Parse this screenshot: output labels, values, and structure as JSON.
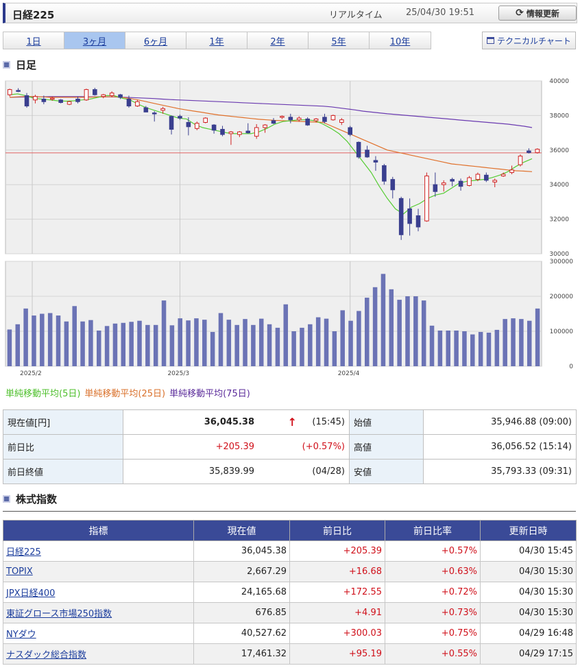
{
  "header": {
    "title": "日経225",
    "realtime_label": "リアルタイム",
    "datetime": "25/04/30 19:51",
    "refresh_label": "情報更新",
    "refresh_icon": "refresh-icon"
  },
  "period_tabs": [
    {
      "label": "1日",
      "active": false
    },
    {
      "label": "3ヶ月",
      "active": true
    },
    {
      "label": "6ヶ月",
      "active": false
    },
    {
      "label": "1年",
      "active": false
    },
    {
      "label": "2年",
      "active": false
    },
    {
      "label": "5年",
      "active": false
    },
    {
      "label": "10年",
      "active": false
    }
  ],
  "technical_button": {
    "label": "テクニカルチャート",
    "icon": "window-icon"
  },
  "chart_section_title": "日足",
  "chart_data": {
    "type": "candlestick",
    "price_axis": {
      "ticks": [
        "40000",
        "38000",
        "36000",
        "34000",
        "32000",
        "30000"
      ],
      "ylim": [
        30000,
        40000
      ]
    },
    "volume_axis": {
      "ticks": [
        "300000",
        "200000",
        "100000",
        "0"
      ],
      "ylim": [
        0,
        300000
      ]
    },
    "x_labels": [
      {
        "label": "2025/2",
        "index": 2
      },
      {
        "label": "2025/3",
        "index": 20
      },
      {
        "label": "2025/4",
        "index": 40
      }
    ],
    "reference_line": 35840,
    "colors": {
      "up": "#d02020",
      "down": "#3a3f8f",
      "ma5": "#55cc33",
      "ma25": "#e0702a",
      "ma75": "#6a3ab0",
      "volume": "#6b73b5"
    },
    "candles": [
      {
        "o": 39200,
        "h": 39550,
        "l": 39100,
        "c": 39500
      },
      {
        "o": 39450,
        "h": 39580,
        "l": 39350,
        "c": 39420
      },
      {
        "o": 39150,
        "h": 39300,
        "l": 38450,
        "c": 38550
      },
      {
        "o": 38900,
        "h": 39200,
        "l": 38700,
        "c": 39100
      },
      {
        "o": 38950,
        "h": 39150,
        "l": 38650,
        "c": 38800
      },
      {
        "o": 38950,
        "h": 39100,
        "l": 38850,
        "c": 39000
      },
      {
        "o": 38900,
        "h": 38950,
        "l": 38700,
        "c": 38750
      },
      {
        "o": 38650,
        "h": 38850,
        "l": 38600,
        "c": 38800
      },
      {
        "o": 38950,
        "h": 39100,
        "l": 38700,
        "c": 38800
      },
      {
        "o": 38900,
        "h": 39550,
        "l": 38850,
        "c": 39500
      },
      {
        "o": 39500,
        "h": 39600,
        "l": 39150,
        "c": 39200
      },
      {
        "o": 39100,
        "h": 39250,
        "l": 39000,
        "c": 39200
      },
      {
        "o": 39150,
        "h": 39400,
        "l": 39050,
        "c": 39300
      },
      {
        "o": 39200,
        "h": 39250,
        "l": 38950,
        "c": 39050
      },
      {
        "o": 38950,
        "h": 39150,
        "l": 38450,
        "c": 38550
      },
      {
        "o": 38550,
        "h": 38900,
        "l": 38500,
        "c": 38800
      },
      {
        "o": 38450,
        "h": 38550,
        "l": 38200,
        "c": 38200
      },
      {
        "o": 38150,
        "h": 38250,
        "l": 37650,
        "c": 38100
      },
      {
        "o": 38300,
        "h": 38500,
        "l": 38100,
        "c": 38400
      },
      {
        "o": 37950,
        "h": 38000,
        "l": 36900,
        "c": 37200
      },
      {
        "o": 37950,
        "h": 38050,
        "l": 37750,
        "c": 37850
      },
      {
        "o": 37600,
        "h": 37900,
        "l": 36850,
        "c": 37350
      },
      {
        "o": 37250,
        "h": 37650,
        "l": 37150,
        "c": 37550
      },
      {
        "o": 37600,
        "h": 37900,
        "l": 37550,
        "c": 37850
      },
      {
        "o": 37450,
        "h": 37500,
        "l": 36950,
        "c": 37150
      },
      {
        "o": 37200,
        "h": 37400,
        "l": 36800,
        "c": 36900
      },
      {
        "o": 36950,
        "h": 37100,
        "l": 36300,
        "c": 37050
      },
      {
        "o": 36900,
        "h": 37100,
        "l": 36750,
        "c": 37050
      },
      {
        "o": 37100,
        "h": 37550,
        "l": 36950,
        "c": 37000
      },
      {
        "o": 36800,
        "h": 37500,
        "l": 36650,
        "c": 37300
      },
      {
        "o": 37300,
        "h": 37500,
        "l": 37000,
        "c": 37450
      },
      {
        "o": 37700,
        "h": 37850,
        "l": 37500,
        "c": 37550
      },
      {
        "o": 37900,
        "h": 38000,
        "l": 37800,
        "c": 37950
      },
      {
        "o": 37900,
        "h": 38100,
        "l": 37550,
        "c": 37750
      },
      {
        "o": 37750,
        "h": 37950,
        "l": 37650,
        "c": 37850
      },
      {
        "o": 37800,
        "h": 37900,
        "l": 37400,
        "c": 37450
      },
      {
        "o": 37700,
        "h": 37850,
        "l": 37600,
        "c": 37800
      },
      {
        "o": 37900,
        "h": 38100,
        "l": 37550,
        "c": 37650
      },
      {
        "o": 37750,
        "h": 38050,
        "l": 37700,
        "c": 38000
      },
      {
        "o": 37600,
        "h": 37850,
        "l": 37450,
        "c": 37750
      },
      {
        "o": 37300,
        "h": 37400,
        "l": 36800,
        "c": 36900
      },
      {
        "o": 36450,
        "h": 36500,
        "l": 35500,
        "c": 35600
      },
      {
        "o": 36000,
        "h": 36250,
        "l": 35550,
        "c": 35600
      },
      {
        "o": 35400,
        "h": 35650,
        "l": 34800,
        "c": 35300
      },
      {
        "o": 35100,
        "h": 35200,
        "l": 34000,
        "c": 34200
      },
      {
        "o": 34300,
        "h": 34450,
        "l": 33200,
        "c": 33700
      },
      {
        "o": 33200,
        "h": 33300,
        "l": 30800,
        "c": 31100
      },
      {
        "o": 32600,
        "h": 33200,
        "l": 31050,
        "c": 31750
      },
      {
        "o": 32200,
        "h": 32600,
        "l": 31300,
        "c": 31550
      },
      {
        "o": 31900,
        "h": 34700,
        "l": 31850,
        "c": 34500
      },
      {
        "o": 34000,
        "h": 34700,
        "l": 33300,
        "c": 33600
      },
      {
        "o": 34000,
        "h": 34250,
        "l": 33600,
        "c": 34100
      },
      {
        "o": 34300,
        "h": 34400,
        "l": 33900,
        "c": 34200
      },
      {
        "o": 34200,
        "h": 34350,
        "l": 33650,
        "c": 33900
      },
      {
        "o": 33950,
        "h": 34500,
        "l": 33900,
        "c": 34400
      },
      {
        "o": 34300,
        "h": 34700,
        "l": 34200,
        "c": 34600
      },
      {
        "o": 34550,
        "h": 34700,
        "l": 34150,
        "c": 34250
      },
      {
        "o": 34150,
        "h": 34350,
        "l": 33850,
        "c": 34250
      },
      {
        "o": 34500,
        "h": 34700,
        "l": 34450,
        "c": 34600
      },
      {
        "o": 34700,
        "h": 35100,
        "l": 34600,
        "c": 34850
      },
      {
        "o": 35150,
        "h": 35750,
        "l": 35050,
        "c": 35650
      },
      {
        "o": 35950,
        "h": 36100,
        "l": 35800,
        "c": 35850
      },
      {
        "o": 35850,
        "h": 36100,
        "l": 35800,
        "c": 36050
      }
    ],
    "volume": [
      105000,
      120000,
      165000,
      145000,
      150000,
      152000,
      145000,
      128000,
      172000,
      128000,
      132000,
      102000,
      115000,
      122000,
      124000,
      127000,
      130000,
      118000,
      118000,
      188000,
      117000,
      137000,
      131000,
      137000,
      133000,
      98000,
      152000,
      133000,
      118000,
      135000,
      118000,
      136000,
      120000,
      110000,
      177000,
      100000,
      110000,
      120000,
      140000,
      136000,
      100000,
      160000,
      130000,
      158000,
      196000,
      226000,
      264000,
      220000,
      190000,
      200000,
      200000,
      188000,
      116000,
      102000,
      102000,
      102000,
      100000,
      91000,
      98000,
      96000,
      104000,
      135000,
      137000,
      135000,
      130000,
      165000
    ],
    "ma5": [
      39200,
      39250,
      39150,
      39000,
      38950,
      38900,
      38850,
      38830,
      38850,
      38900,
      38950,
      39050,
      39150,
      39150,
      39000,
      38900,
      38650,
      38450,
      38300,
      38150,
      38000,
      37850,
      37800,
      37500,
      37300,
      37200,
      37100,
      37000,
      36950,
      36950,
      36950,
      37050,
      37250,
      37500,
      37650,
      37700,
      37750,
      37750,
      37700,
      37500,
      37250,
      36950,
      36500,
      35900,
      35300,
      34700,
      33900,
      33200,
      32600,
      32300,
      32700,
      32900,
      33200,
      33400,
      33500,
      33800,
      34100,
      34200,
      34250,
      34300,
      34400,
      34550,
      34750,
      35050,
      35300,
      35500
    ],
    "ma25": [
      39050,
      39080,
      39100,
      39100,
      39080,
      39050,
      39050,
      39050,
      39050,
      39050,
      39060,
      39070,
      39080,
      39080,
      39050,
      38980,
      38900,
      38800,
      38700,
      38600,
      38500,
      38400,
      38320,
      38250,
      38180,
      38100,
      38030,
      37980,
      37930,
      37880,
      37830,
      37780,
      37750,
      37720,
      37700,
      37680,
      37660,
      37640,
      37620,
      37600,
      37400,
      37200,
      37000,
      36800,
      36600,
      36400,
      36200,
      36000,
      35900,
      35800,
      35700,
      35600,
      35500,
      35400,
      35300,
      35200,
      35150,
      35100,
      35050,
      35000,
      34950,
      34900,
      34850,
      34800,
      34780,
      34750
    ],
    "ma75": [
      39050,
      39060,
      39070,
      39080,
      39080,
      39090,
      39090,
      39090,
      39090,
      39090,
      39080,
      39080,
      39080,
      39070,
      39060,
      39040,
      39020,
      39000,
      38980,
      38950,
      38920,
      38900,
      38880,
      38860,
      38840,
      38820,
      38800,
      38780,
      38760,
      38740,
      38720,
      38700,
      38680,
      38660,
      38640,
      38620,
      38600,
      38580,
      38560,
      38540,
      38500,
      38440,
      38380,
      38320,
      38250,
      38200,
      38150,
      38100,
      38060,
      38020,
      37980,
      37940,
      37900,
      37860,
      37820,
      37780,
      37740,
      37700,
      37660,
      37620,
      37580,
      37540,
      37500,
      37440,
      37380,
      37300
    ]
  },
  "legend": [
    {
      "label": "単純移動平均(5日)",
      "color": "#55cc33"
    },
    {
      "label": "単純移動平均(25日)",
      "color": "#e0702a"
    },
    {
      "label": "単純移動平均(75日)",
      "color": "#6a3ab0"
    }
  ],
  "quote": {
    "current_label": "現在値[円]",
    "current_value": "36,045.38",
    "arrow": "↑",
    "current_time": "(15:45)",
    "open_label": "始値",
    "open_value": "35,946.88 (09:00)",
    "change_label": "前日比",
    "change_value": "+205.39",
    "change_pct": "(+0.57%)",
    "high_label": "高値",
    "high_value": "36,056.52 (15:14)",
    "prev_label": "前日終値",
    "prev_value": "35,839.99",
    "prev_date": "(04/28)",
    "low_label": "安値",
    "low_value": "35,793.33 (09:31)"
  },
  "index_section_title": "株式指数",
  "index_table": {
    "headers": [
      "指標",
      "現在値",
      "前日比",
      "前日比率",
      "更新日時"
    ],
    "rows": [
      {
        "name": "日経225",
        "value": "36,045.38",
        "change": "+205.39",
        "pct": "+0.57%",
        "updated": "04/30 15:45"
      },
      {
        "name": "TOPIX",
        "value": "2,667.29",
        "change": "+16.68",
        "pct": "+0.63%",
        "updated": "04/30 15:30"
      },
      {
        "name": "JPX日経400",
        "value": "24,165.68",
        "change": "+172.55",
        "pct": "+0.72%",
        "updated": "04/30 15:30"
      },
      {
        "name": "東証グロース市場250指数",
        "value": "676.85",
        "change": "+4.91",
        "pct": "+0.73%",
        "updated": "04/30 15:30"
      },
      {
        "name": "NYダウ",
        "value": "40,527.62",
        "change": "+300.03",
        "pct": "+0.75%",
        "updated": "04/29 16:48"
      },
      {
        "name": "ナスダック総合指数",
        "value": "17,461.32",
        "change": "+95.19",
        "pct": "+0.55%",
        "updated": "04/29 17:15"
      }
    ]
  }
}
